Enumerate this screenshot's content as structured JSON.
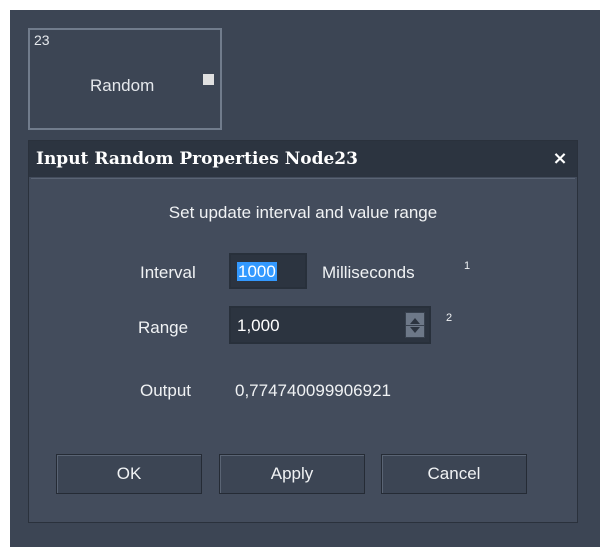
{
  "node": {
    "id": "23",
    "title": "Random"
  },
  "dialog": {
    "title": "Input Random Properties Node23",
    "close_glyph": "×",
    "description": "Set update interval and value range",
    "interval": {
      "label": "Interval",
      "value": "1000",
      "unit": "Milliseconds",
      "superscript": "1"
    },
    "range": {
      "label": "Range",
      "value": "1,000",
      "superscript": "2"
    },
    "output": {
      "label": "Output",
      "value": "0,774740099906921"
    },
    "buttons": {
      "ok": "OK",
      "apply": "Apply",
      "cancel": "Cancel"
    }
  },
  "colors": {
    "canvas_bg": "#3c4554",
    "dialog_bg": "#434c5c",
    "titlebar_bg": "#2c3440",
    "selection": "#3399ff"
  }
}
